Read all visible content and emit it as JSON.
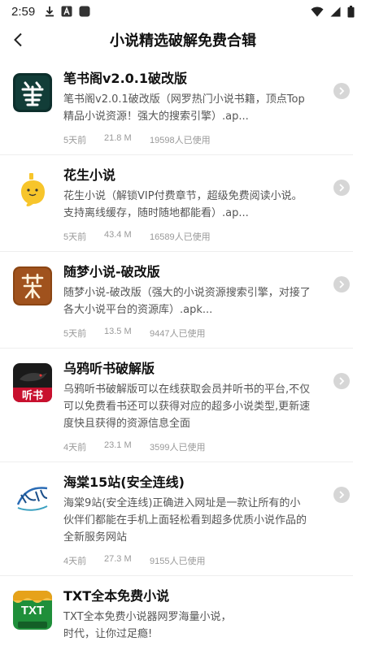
{
  "status_bar": {
    "time": "2:59"
  },
  "header": {
    "title": "小说精选破解免费合辑"
  },
  "items": [
    {
      "title": "笔书阁v2.0.1破改版",
      "desc": "笔书阁v2.0.1破改版（网罗热门小说书籍，顶点Top精品小说资源！强大的搜索引擎）.ap...",
      "days": "5天前",
      "size": "21.8 M",
      "users": "19598人已使用",
      "icon": "bishuge-icon"
    },
    {
      "title": "花生小说",
      "desc": "花生小说（解锁VIP付费章节，超级免费阅读小说。支持离线缓存，随时随地都能看）.ap...",
      "days": "5天前",
      "size": "43.4 M",
      "users": "16589人已使用",
      "icon": "huasheng-icon"
    },
    {
      "title": "随梦小说-破改版",
      "desc": "随梦小说-破改版（强大的小说资源搜索引擎，对接了各大小说平台的资源库）.apk...",
      "days": "5天前",
      "size": "13.5 M",
      "users": "9447人已使用",
      "icon": "suimeng-icon"
    },
    {
      "title": "乌鸦听书破解版",
      "desc": "乌鸦听书破解版可以在线获取会员并听书的平台,不仅可以免费看书还可以获得对应的超多小说类型,更新速度快且获得的资源信息全面",
      "days": "4天前",
      "size": "23.1 M",
      "users": "3599人已使用",
      "icon": "wuya-icon",
      "icon_text": "听书"
    },
    {
      "title": "海棠15站(安全连线)",
      "desc": "海棠9站(安全连线)正确进入网址是一款让所有的小伙伴们都能在手机上面轻松看到超多优质小说作品的全新服务网站",
      "days": "4天前",
      "size": "27.3 M",
      "users": "9155人已使用",
      "icon": "haitang-icon"
    },
    {
      "title": "TXT全本免费小说",
      "desc": "TXT全本免费小说器网罗海量小说，\n时代，让你过足瘾!",
      "days": "",
      "size": "",
      "users": "",
      "icon": "txt-icon",
      "icon_text": "TXT"
    }
  ],
  "colors": {
    "accent": "#111111",
    "muted": "#999999",
    "chevron_bg": "#d6d6d6"
  }
}
